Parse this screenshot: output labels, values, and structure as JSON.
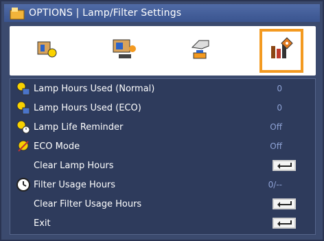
{
  "title": "OPTIONS | Lamp/Filter Settings",
  "tabs": [
    {
      "name": "image-tab",
      "icon": "picture-sun-icon"
    },
    {
      "name": "display-tab",
      "icon": "display-settings-icon"
    },
    {
      "name": "setup-tab",
      "icon": "setup-hand-icon"
    },
    {
      "name": "options-tab",
      "icon": "options-bars-icon",
      "active": true
    }
  ],
  "menu": [
    {
      "label": "Lamp Hours Used (Normal)",
      "value": "0",
      "icon": "lamp-hours-icon"
    },
    {
      "label": "Lamp Hours Used (ECO)",
      "value": "0",
      "icon": "lamp-hours-icon"
    },
    {
      "label": "Lamp Life Reminder",
      "value": "Off",
      "icon": "lamp-clock-icon"
    },
    {
      "label": "ECO Mode",
      "value": "Off",
      "icon": "eco-icon"
    },
    {
      "label": "Clear Lamp Hours",
      "value": "",
      "icon": "",
      "enter": true
    },
    {
      "label": "Filter Usage Hours",
      "value": "0/--",
      "icon": "clock-icon"
    },
    {
      "label": "Clear Filter Usage Hours",
      "value": "",
      "icon": "",
      "enter": true
    },
    {
      "label": "Exit",
      "value": "",
      "icon": "",
      "enter": true
    }
  ],
  "colors": {
    "accent": "#f39a21",
    "value_text": "#8fa3d6",
    "panel": "#2e3b5c"
  }
}
